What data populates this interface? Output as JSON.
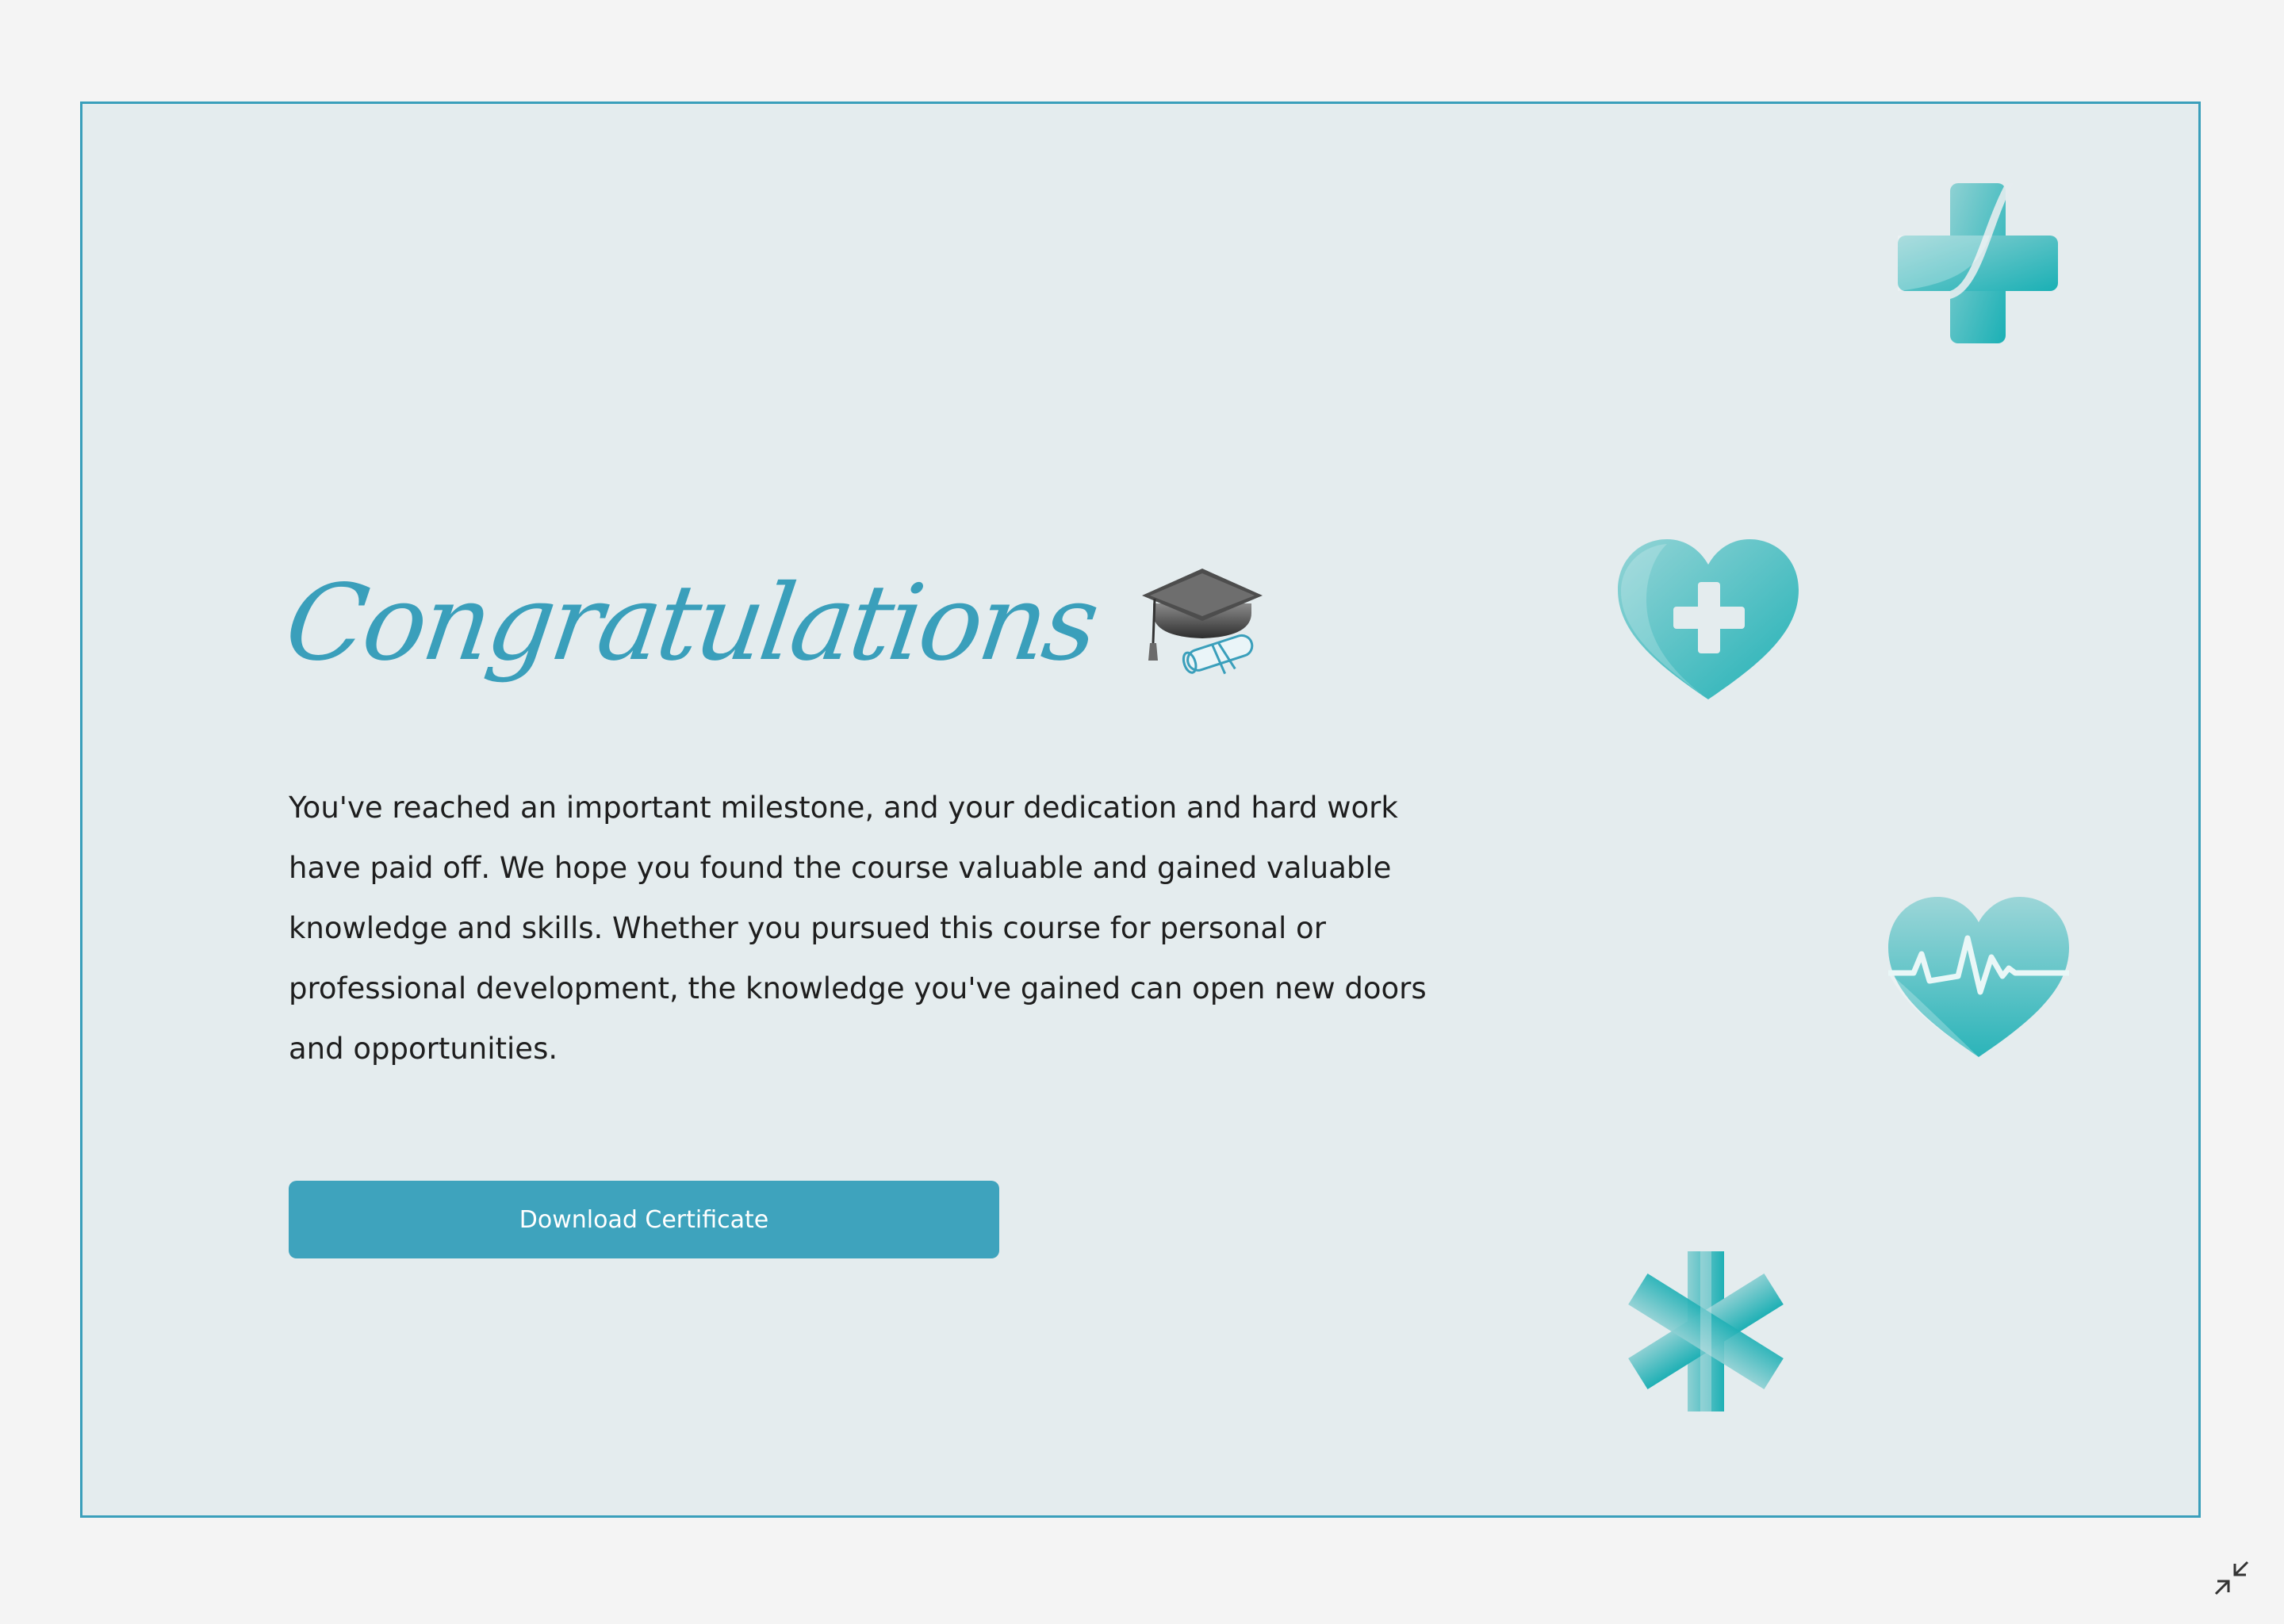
{
  "certificate": {
    "title": "Congratulations",
    "title_icon": "graduation-cap-icon",
    "message": "You've reached an important milestone, and your dedication and hard work have paid off. We hope you found the course valuable and gained valuable knowledge and skills. Whether you pursued this course for personal or professional development, the knowledge you've gained can open new doors and opportunities.",
    "download_label": "Download Certificate"
  },
  "decorations": [
    "medical-cross-icon",
    "heart-plus-icon",
    "heartbeat-heart-icon",
    "medical-asterisk-icon"
  ],
  "window_controls": {
    "minimize_icon": "exit-fullscreen-icon"
  },
  "colors": {
    "accent": "#3a9fbb",
    "button": "#3ea3bd",
    "card_background": "#e4ecee",
    "page_background": "#f4f4f4",
    "teal_icon": "#2bb3b8",
    "text": "#1e1e1e"
  }
}
